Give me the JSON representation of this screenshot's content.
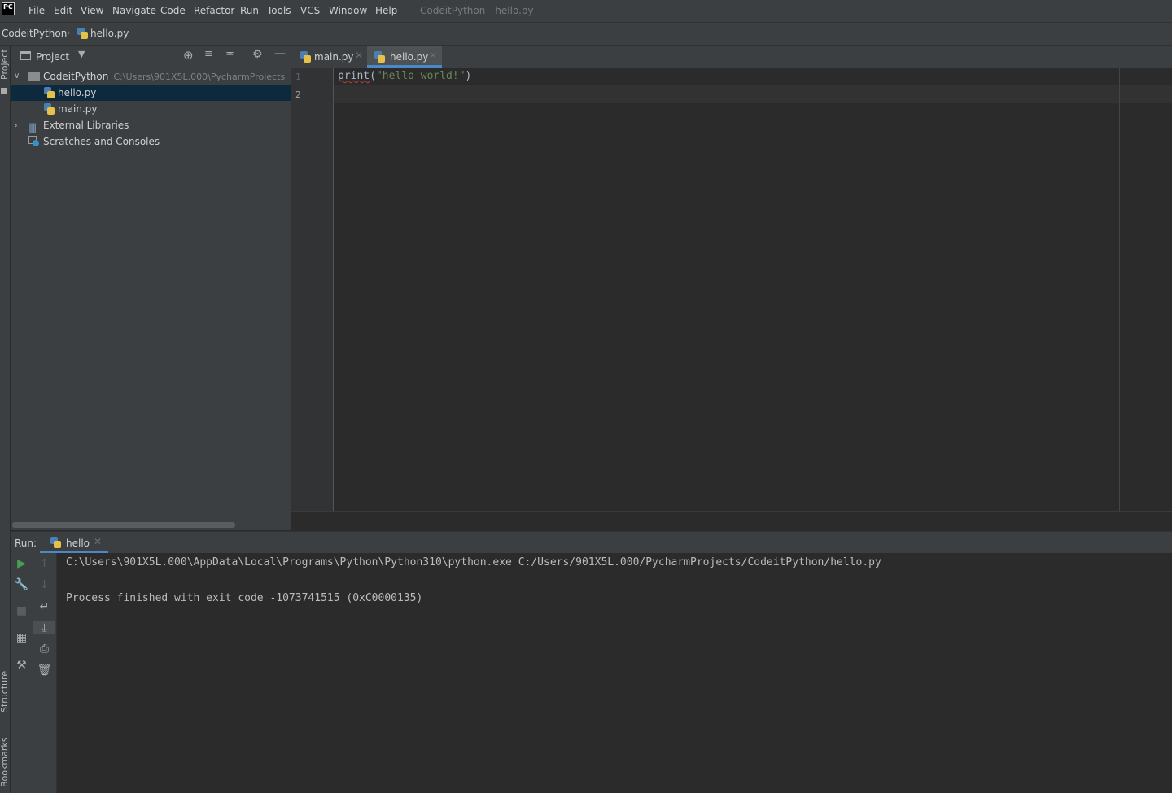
{
  "menubar": {
    "logo": "PC",
    "items": [
      "File",
      "Edit",
      "View",
      "Navigate",
      "Code",
      "Refactor",
      "Run",
      "Tools",
      "VCS",
      "Window",
      "Help"
    ],
    "window_title": "CodeitPython - hello.py"
  },
  "breadcrumb": {
    "project": "CodeitPython",
    "file": "hello.py"
  },
  "left_stripe": {
    "project": "Project",
    "structure": "Structure",
    "bookmarks": "Bookmarks"
  },
  "project_panel": {
    "title": "Project",
    "tree": {
      "root_name": "CodeitPython",
      "root_path": "C:\\Users\\901X5L.000\\PycharmProjects",
      "files": [
        "hello.py",
        "main.py"
      ],
      "external_libraries": "External Libraries",
      "scratches": "Scratches and Consoles"
    }
  },
  "editor": {
    "tabs": [
      {
        "label": "main.py"
      },
      {
        "label": "hello.py"
      }
    ],
    "line_numbers": [
      "1",
      "2"
    ],
    "code": {
      "fn": "print",
      "open": "(",
      "str": "\"hello world!\"",
      "close": ")"
    }
  },
  "run_panel": {
    "label": "Run:",
    "tab": "hello",
    "console": [
      "C:\\Users\\901X5L.000\\AppData\\Local\\Programs\\Python\\Python310\\python.exe C:/Users/901X5L.000/PycharmProjects/CodeitPython/hello.py",
      "",
      "Process finished with exit code -1073741515 (0xC0000135)"
    ]
  },
  "colors": {
    "accent": "#4a88c7",
    "selection": "#0d293e",
    "string": "#6a8759",
    "run_green": "#499c54"
  }
}
